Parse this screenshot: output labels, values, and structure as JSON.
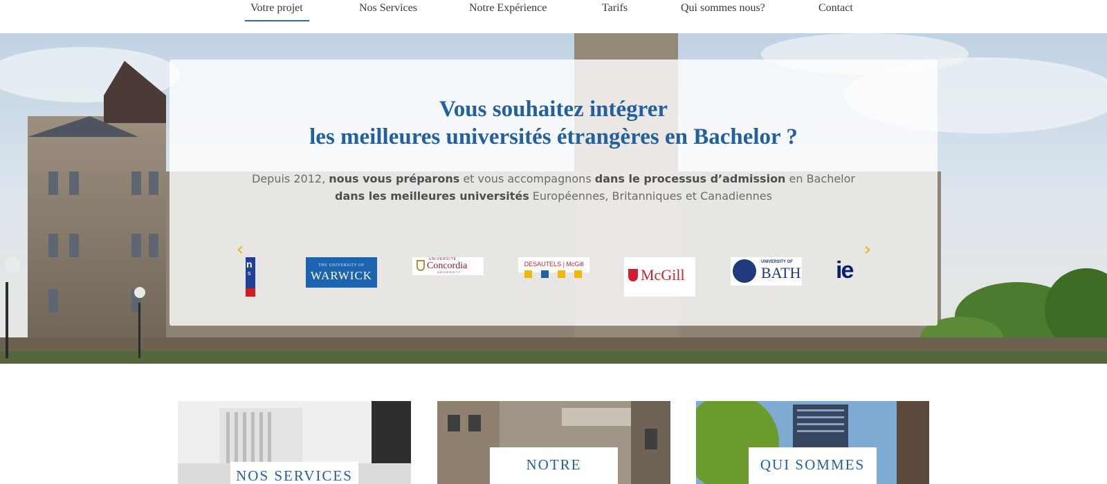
{
  "nav": {
    "items": [
      {
        "label": "Votre projet",
        "active": true
      },
      {
        "label": "Nos Services"
      },
      {
        "label": "Notre Expérience"
      },
      {
        "label": "Tarifs"
      },
      {
        "label": "Qui sommes nous?"
      },
      {
        "label": "Contact"
      }
    ]
  },
  "hero": {
    "headline_line1": "Vous souhaitez intégrer",
    "headline_line2": "les meilleures universités étrangères en Bachelor ?",
    "sub": {
      "l1_a": "Depuis 2012, ",
      "l1_b": "nous vous préparons",
      "l1_c": " et vous accompagnons ",
      "l1_d": "dans le processus d’admission",
      "l1_e": " en Bachelor",
      "l2_a": "dans les meilleures universités",
      "l2_b": " Européennes, Britanniques et Canadiennes"
    },
    "carousel": {
      "prev_icon": "‹",
      "next_icon": "›",
      "logos": [
        {
          "name": "partial-logo",
          "text_main": "n",
          "text_sub": "s"
        },
        {
          "name": "warwick",
          "text_small": "THE UNIVERSITY OF",
          "text_main": "WARWICK"
        },
        {
          "name": "concordia",
          "text_small": "UNIVERSITÉ",
          "text_main": "Concordia",
          "text_sub": "UNIVERSITY"
        },
        {
          "name": "desautels-mcgill",
          "text_main": "DESAUTELS | McGill"
        },
        {
          "name": "mcgill",
          "text_main": "McGill"
        },
        {
          "name": "bath",
          "text_small": "UNIVERSITY OF",
          "text_main": "BATH"
        },
        {
          "name": "ie",
          "text_main": "ie"
        }
      ],
      "dots": 4,
      "active_dot": 1
    }
  },
  "cards": [
    {
      "label": "NOS SERVICES"
    },
    {
      "label": "NOTRE"
    },
    {
      "label": "QUI SOMMES"
    }
  ],
  "colors": {
    "brand_blue": "#23609e",
    "accent_gold": "#efb80a",
    "warwick_blue": "#1d64b0",
    "mcgill_red": "#cf1f30"
  }
}
